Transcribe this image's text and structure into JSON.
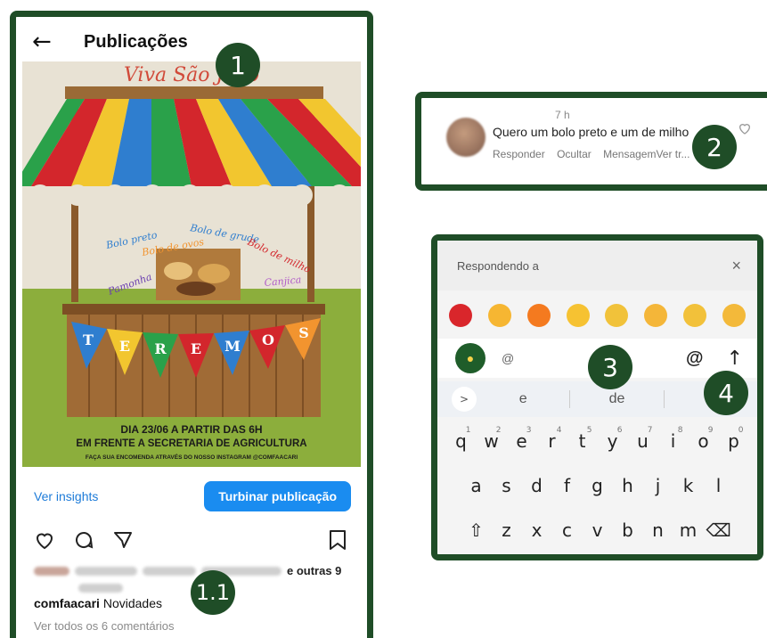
{
  "post_panel": {
    "title": "Publicações",
    "poster": {
      "header": "Viva São João",
      "stall_labels": [
        "Bolo preto",
        "Bolo de ovos",
        "Bolo de grude",
        "Bolo de milho",
        "Pamonha",
        "Canjica"
      ],
      "banner_letters": [
        "T",
        "E",
        "R",
        "E",
        "M",
        "O",
        "S"
      ],
      "line1": "DIA 23/06 A PARTIR DAS 6H",
      "line2": "EM FRENTE A SECRETARIA DE AGRICULTURA",
      "line3": "FAÇA SUA ENCOMENDA ATRAVÉS DO NOSSO INSTAGRAM @COMFAACARI"
    },
    "insights_label": "Ver insights",
    "boost_label": "Turbinar publicação",
    "likes_suffix": "e outras 9",
    "caption_user": "comfaacari",
    "caption_text": "Novidades",
    "comments_link": "Ver todos os 6 comentários"
  },
  "comment_panel": {
    "time": "7 h",
    "text": "Quero um bolo preto e um de milho",
    "actions": [
      "Responder",
      "Ocultar",
      "MensagemVer tr..."
    ]
  },
  "keyboard_panel": {
    "replying_label": "Respondendo a",
    "close_glyph": "×",
    "emoji_colors": [
      "#d9262b",
      "#f6b632",
      "#f47a1f",
      "#f6c232",
      "#f1c23a",
      "#f4b639",
      "#f2c13a",
      "#f3b93a"
    ],
    "at_small": "@",
    "at_big": "@",
    "suggestions": [
      "e",
      "de",
      "a"
    ],
    "row1": [
      {
        "k": "q",
        "n": "1"
      },
      {
        "k": "w",
        "n": "2"
      },
      {
        "k": "e",
        "n": "3"
      },
      {
        "k": "r",
        "n": "4"
      },
      {
        "k": "t",
        "n": "5"
      },
      {
        "k": "y",
        "n": "6"
      },
      {
        "k": "u",
        "n": "7"
      },
      {
        "k": "i",
        "n": "8"
      },
      {
        "k": "o",
        "n": "9"
      },
      {
        "k": "p",
        "n": "0"
      }
    ],
    "row2": [
      "a",
      "s",
      "d",
      "f",
      "g",
      "h",
      "j",
      "k",
      "l"
    ],
    "row3": [
      "⇧",
      "z",
      "x",
      "c",
      "v",
      "b",
      "n",
      "m",
      "⌫"
    ]
  },
  "badges": {
    "b1": "1",
    "b11": "1.1",
    "b2": "2",
    "b3": "3",
    "b4": "4"
  },
  "colors": {
    "frame": "#1f4d27",
    "accent_blue": "#1a8cf0"
  }
}
